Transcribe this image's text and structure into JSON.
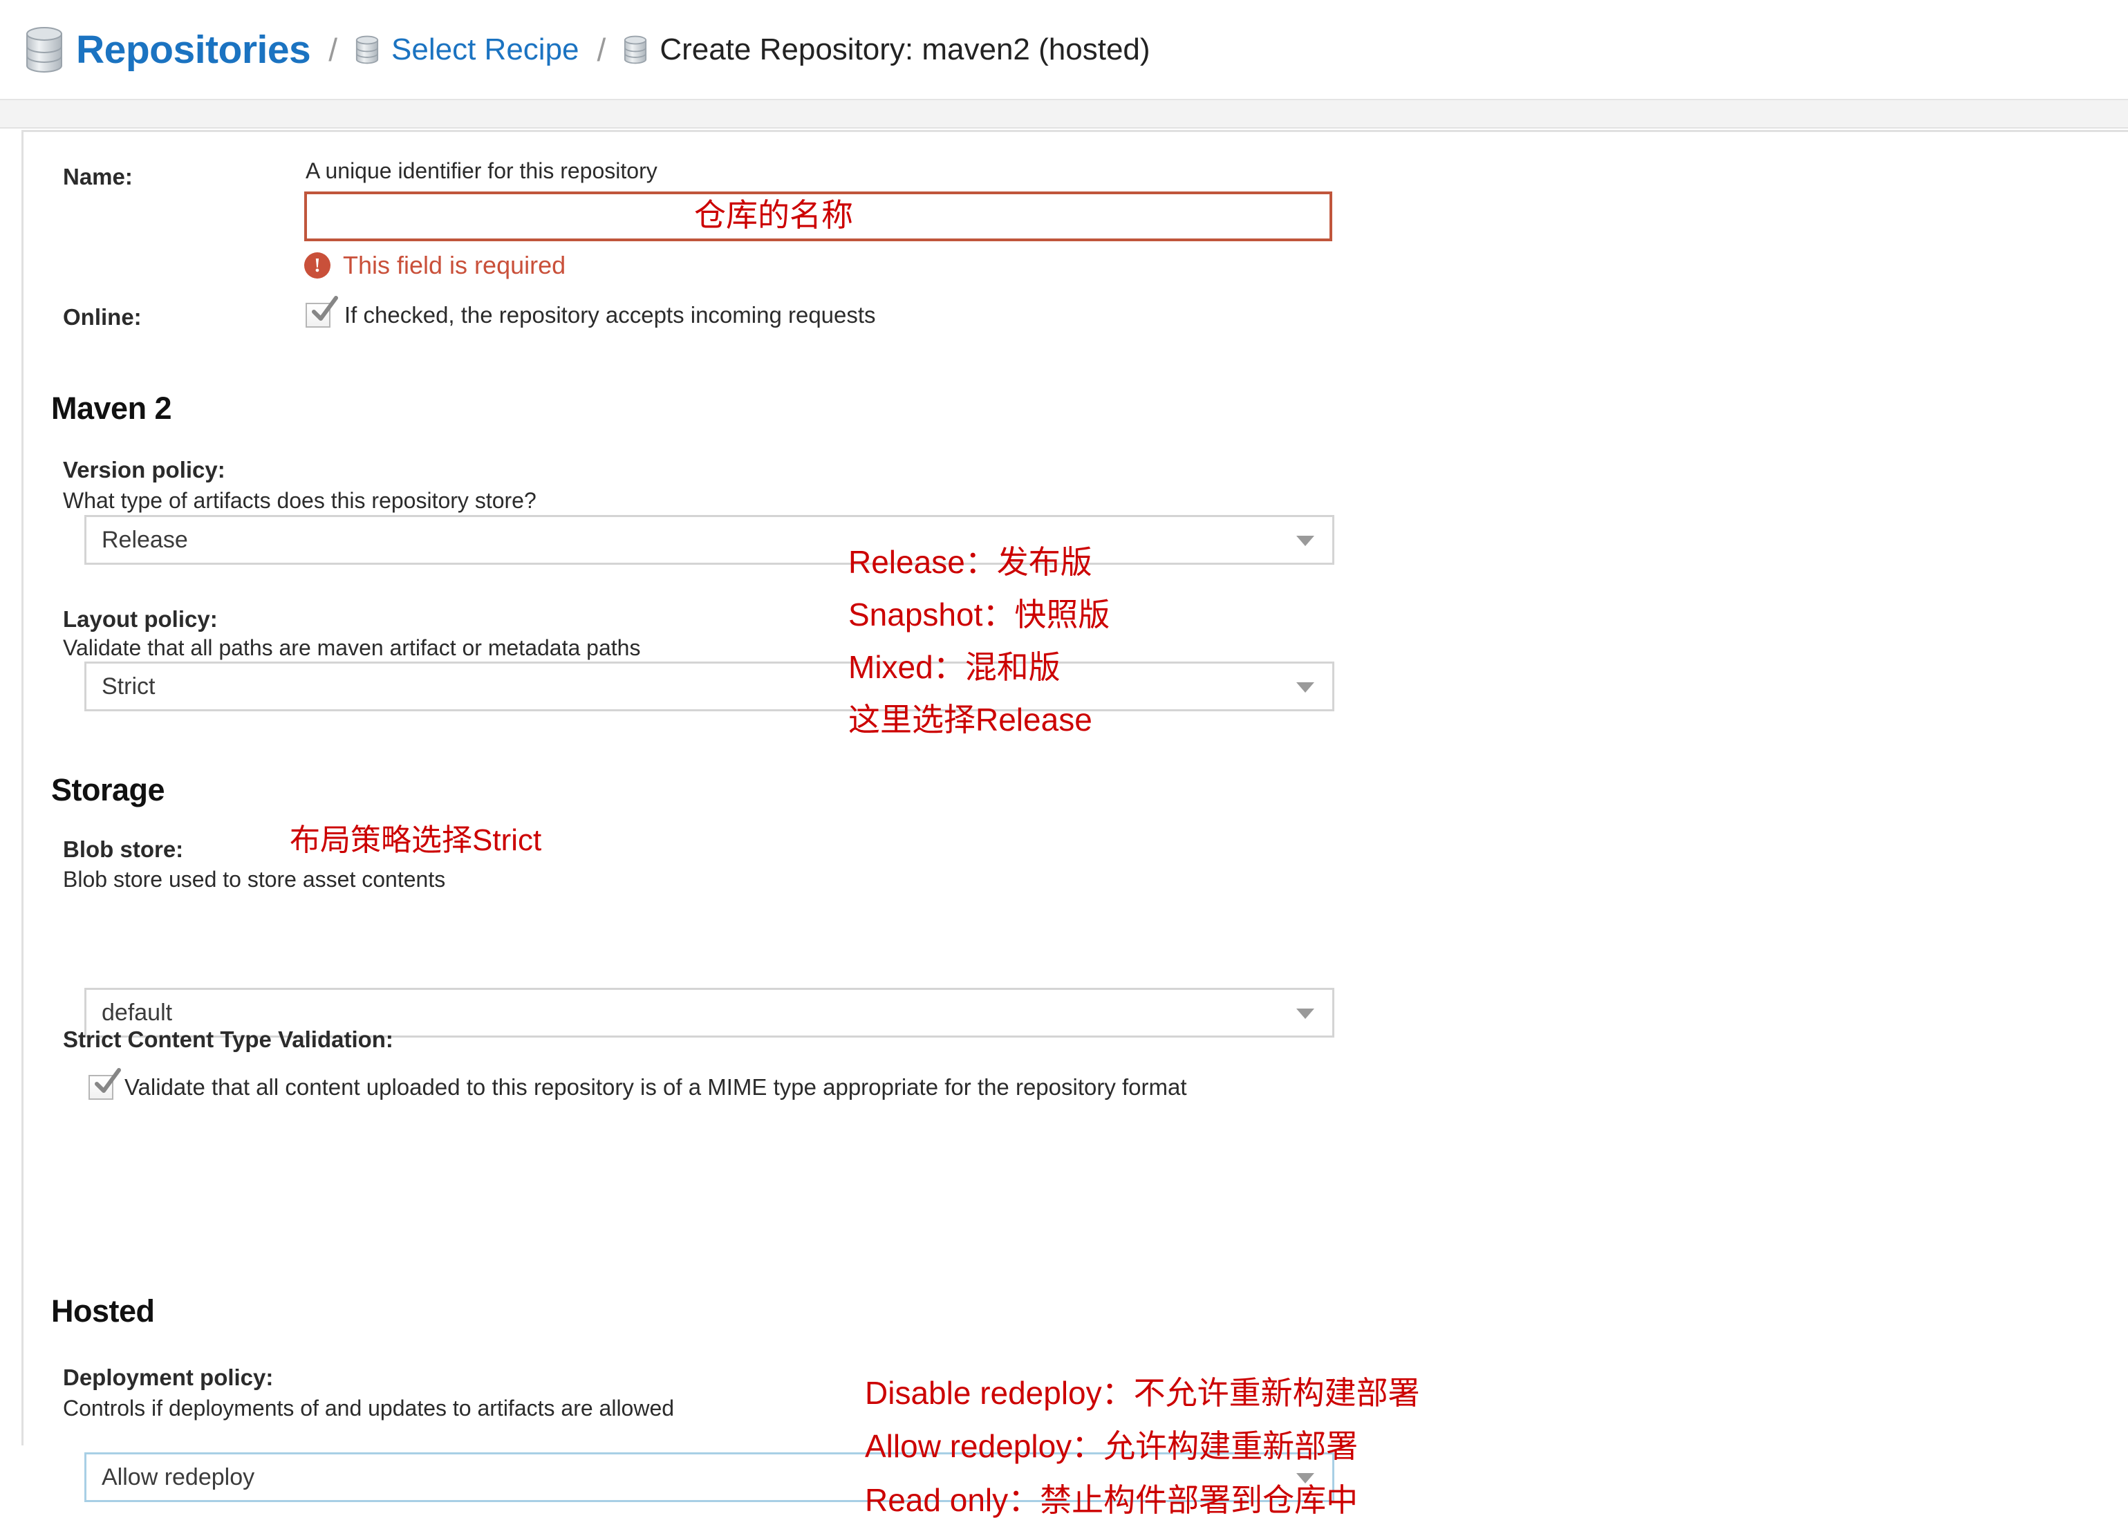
{
  "breadcrumb": {
    "items": [
      {
        "label": "Repositories",
        "icon": "database-icon"
      },
      {
        "label": "Select Recipe",
        "icon": "database-icon"
      },
      {
        "label": "Create Repository: maven2 (hosted)",
        "icon": "database-icon"
      }
    ],
    "separator": "/"
  },
  "colors": {
    "link": "#1b73c1",
    "error": "#c9503a",
    "annotation": "#cc0000",
    "input_error_border": "#c0563c",
    "input_focus_border": "#a8cfe5",
    "select_border": "#d4d4d4"
  },
  "form": {
    "name": {
      "label": "Name:",
      "helper": "A unique identifier for this repository",
      "value": "",
      "placeholder": "",
      "error": "This field is required",
      "error_icon": "exclamation-circle-icon"
    },
    "online": {
      "label": "Online:",
      "checkbox_label": "If checked, the repository accepts incoming requests",
      "checked": true
    }
  },
  "maven": {
    "title": "Maven 2",
    "version_policy": {
      "label": "Version policy:",
      "helper": "What type of artifacts does this repository store?",
      "value": "Release"
    },
    "layout_policy": {
      "label": "Layout policy:",
      "helper": "Validate that all paths are maven artifact or metadata paths",
      "value": "Strict"
    }
  },
  "storage": {
    "title": "Storage",
    "blob_store": {
      "label": "Blob store:",
      "helper": "Blob store used to store asset contents",
      "value": "default"
    },
    "strict_content_type": {
      "label": "Strict Content Type Validation:",
      "checkbox_label": "Validate that all content uploaded to this repository is of a MIME type appropriate for the repository format",
      "checked": true
    }
  },
  "hosted": {
    "title": "Hosted",
    "deployment_policy": {
      "label": "Deployment policy:",
      "helper": "Controls if deployments of and updates to artifacts are allowed",
      "value": "Allow redeploy"
    }
  },
  "annotations": {
    "name_field": "仓库的名称",
    "release": "Release：发布版",
    "snapshot": "Snapshot：快照版",
    "mixed": "Mixed：混和版",
    "choose_release": "这里选择Release",
    "layout_strict": "布局策略选择Strict",
    "disable_redeploy": "Disable redeploy：不允许重新构建部署",
    "allow_redeploy": "Allow redeploy：允许构建重新部署",
    "read_only": "Read only：禁止构件部署到仓库中"
  }
}
